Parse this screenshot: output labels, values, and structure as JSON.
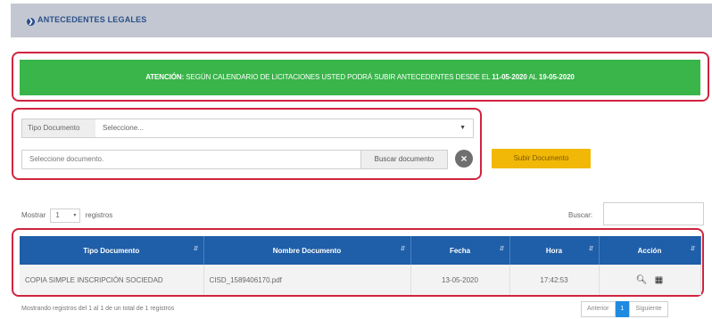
{
  "header": {
    "title": "ANTECEDENTES LEGALES",
    "icon": "circle-arrow-icon"
  },
  "alert": {
    "prefix": "ATENCIÓN:",
    "message": "SEGÚN CALENDARIO DE LICITACIONES USTED PODRÁ SUBIR ANTECEDENTES DESDE EL",
    "date_from": "11-05-2020",
    "connector": "AL",
    "date_to": "19-05-2020",
    "color": "#39b54a"
  },
  "form": {
    "doc_type_label": "Tipo Documento",
    "doc_type_value": "Seleccione...",
    "file_placeholder": "Seleccione documento.",
    "browse_label": "Buscar documento",
    "upload_label": "Subir Documento"
  },
  "table_controls": {
    "show_label": "Mostrar",
    "page_length": "1",
    "records_label": "registros",
    "search_label": "Buscar:"
  },
  "table": {
    "columns": [
      "Tipo Documento",
      "Nombre Documento",
      "Fecha",
      "Hora",
      "Acción"
    ],
    "rows": [
      {
        "tipo": "COPIA SIMPLE INSCRIPCIÓN SOCIEDAD",
        "nombre": "CISD_1589406170.pdf",
        "fecha": "13-05-2020",
        "hora": "17:42:53"
      }
    ],
    "header_color": "#1f5ea8"
  },
  "footer": {
    "info": "Mostrando registros del 1 al 1 de un total de 1 registros",
    "prev_label": "Anterior",
    "current_page": "1",
    "next_label": "Siguiente"
  }
}
